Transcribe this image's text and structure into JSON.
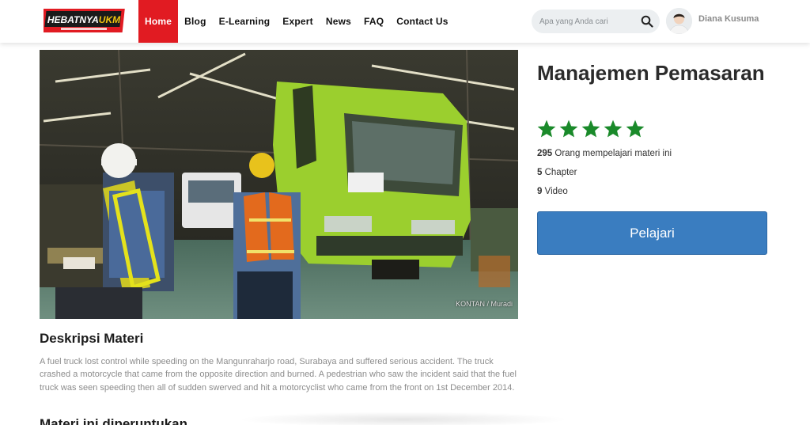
{
  "header": {
    "logo_text": "HEBATNYAUKM",
    "nav": [
      {
        "label": "Home",
        "active": true
      },
      {
        "label": "Blog",
        "active": false
      },
      {
        "label": "E-Learning",
        "active": false
      },
      {
        "label": "Expert",
        "active": false
      },
      {
        "label": "News",
        "active": false
      },
      {
        "label": "FAQ",
        "active": false
      },
      {
        "label": "Contact Us",
        "active": false
      }
    ],
    "search": {
      "placeholder": "Apa yang Anda cari",
      "icon": "search-icon"
    },
    "user": {
      "name": "Diana Kusuma",
      "icon": "avatar"
    }
  },
  "hero": {
    "photo_credit": "KONTAN / Muradi"
  },
  "course": {
    "title": "Manajemen Pemasaran",
    "rating": 5,
    "rating_max": 5,
    "star_color": "#1a8a2a",
    "learners_count": "295",
    "learners_text": " Orang mempelajari materi ini",
    "chapters_count": "5",
    "chapters_text": " Chapter",
    "videos_count": "9",
    "videos_text": " Video",
    "cta_label": "Pelajari",
    "cta_color": "#3a7dc0"
  },
  "description": {
    "title": "Deskripsi Materi",
    "text": "A fuel truck lost control while speeding on the Mangunraharjo road, Surabaya and suffered serious accident. The truck crashed a motorcycle that came from the opposite direction and burned. A pedestrian who saw the incident said that the fuel truck was seen speeding then all of sudden swerved and hit a motorcyclist who came from the front on 1st December 2014."
  },
  "next_section": {
    "title": "Materi ini diperuntukan"
  },
  "colors": {
    "brand_red": "#e11b22",
    "primary_blue": "#3a7dc0"
  }
}
